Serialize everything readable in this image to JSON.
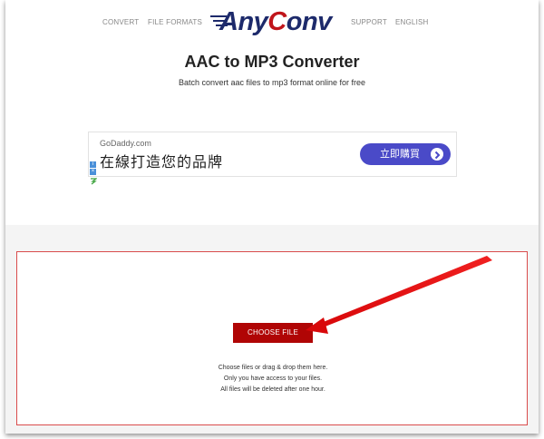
{
  "nav": {
    "convert": "CONVERT",
    "file_formats": "FILE FORMATS",
    "support": "SUPPORT",
    "english": "ENGLISH"
  },
  "logo": {
    "text_any": "Any",
    "text_c": "C",
    "text_onv": "onv"
  },
  "page": {
    "title": "AAC to MP3 Converter",
    "subtitle": "Batch convert aac files to mp3 format online for free"
  },
  "ad": {
    "domain": "GoDaddy.com",
    "headline": "在線打造您的品牌",
    "cta": "立即購買",
    "info_icon": "info-icon",
    "close_icon": "close-icon"
  },
  "upload": {
    "button": "CHOOSE FILE",
    "line1": "Choose files or drag & drop them here.",
    "line2": "Only you have access to your files.",
    "line3": "All files will be deleted after one hour."
  },
  "colors": {
    "accent_red": "#b00505",
    "logo_navy": "#1d2a6b",
    "ad_button": "#4a4ac8"
  }
}
